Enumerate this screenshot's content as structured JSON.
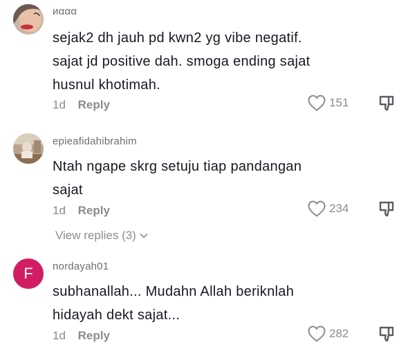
{
  "comments": [
    {
      "username": "иααα",
      "text_lines": [
        "sejak2 dh jauh pd kwn2 yg vibe negatif.",
        "sajat jd positive dah. smoga ending sajat",
        "husnul khotimah."
      ],
      "time": "1d",
      "reply_label": "Reply",
      "likes": "151",
      "avatar": "photo"
    },
    {
      "username": "epieafidahibrahim",
      "text_lines": [
        "Ntah ngape skrg setuju tiap pandangan",
        "sajat"
      ],
      "time": "1d",
      "reply_label": "Reply",
      "likes": "234",
      "avatar": "photo"
    },
    {
      "username": "nordayah01",
      "text_lines": [
        "subhanallah... Mudahn Allah beriknlah",
        "hidayah dekt sajat..."
      ],
      "time": "1d",
      "reply_label": "Reply",
      "likes": "282",
      "avatar": "F",
      "avatar_color": "#d11d63"
    }
  ],
  "view_replies": {
    "label": "View replies (3)",
    "icon": "chevron-down-icon"
  },
  "icons": {
    "like": "heart-outline-icon",
    "dislike": "thumbs-down-icon"
  }
}
